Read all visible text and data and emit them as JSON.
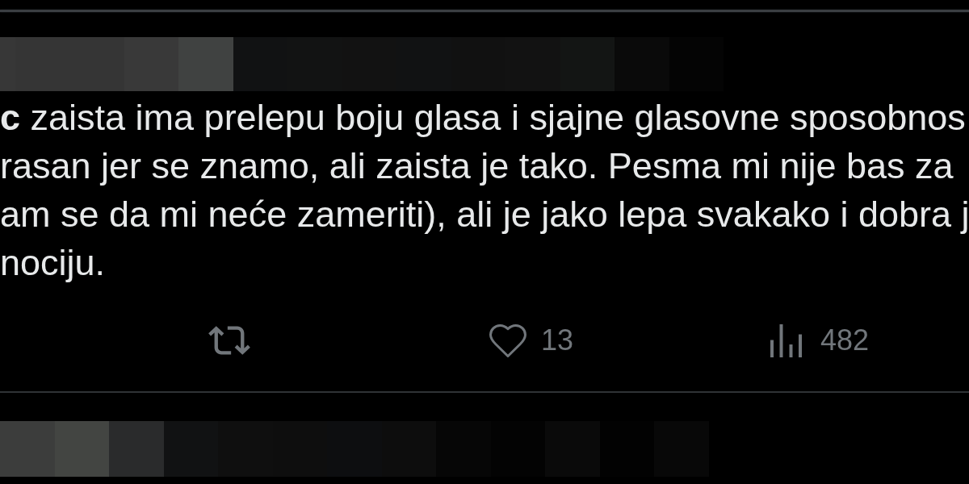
{
  "header": {
    "name_pixelated": true
  },
  "tweet": {
    "text_lines": [
      "**c** zaista ima prelepu boju glasa i sjajne glasovne sposobnos",
      "rasan jer se znamo, ali zaista je tako. Pesma mi nije bas za",
      "am se da mi neće zameriti), ali je jako lepa svakako i dobra j",
      "nociju."
    ]
  },
  "actions": [
    {
      "kind": "repost"
    },
    {
      "kind": "like",
      "count": "13"
    },
    {
      "kind": "views",
      "count": "482"
    }
  ],
  "next_post": {
    "name_pixelated": true
  }
}
